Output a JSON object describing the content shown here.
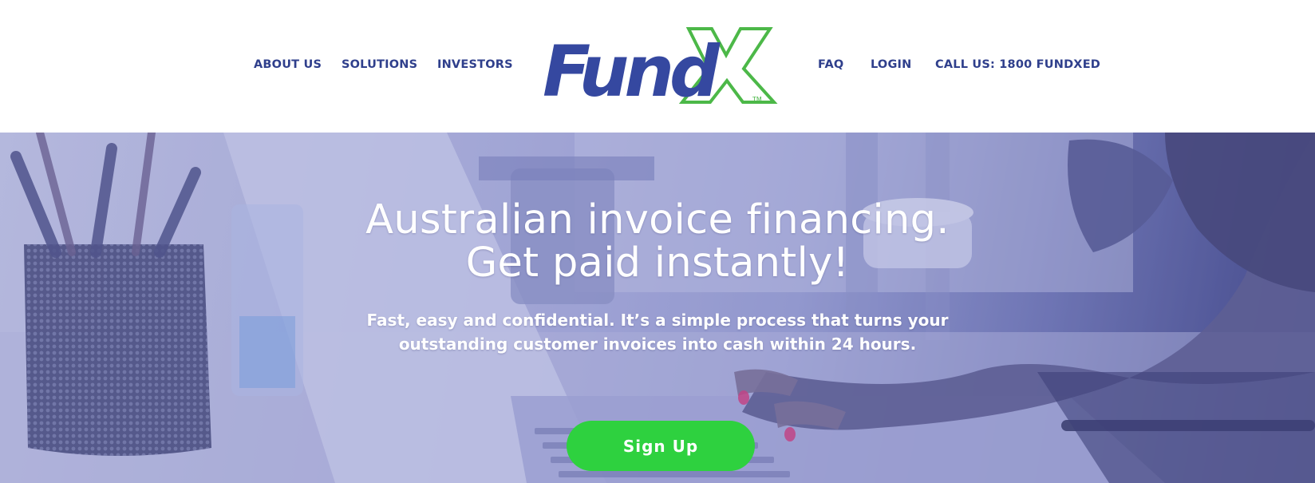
{
  "header": {
    "nav_left": [
      "ABOUT US",
      "SOLUTIONS",
      "INVESTORS"
    ],
    "nav_right": [
      "FAQ",
      "LOGIN",
      "CALL US: 1800 FUNDXED"
    ],
    "logo": {
      "text": "Fund",
      "mark": "X",
      "trademark": "TM",
      "brand_color": "#3548a0",
      "accent_color": "#4cb848"
    }
  },
  "hero": {
    "title_line1": "Australian invoice financing.",
    "title_line2": "Get paid instantly!",
    "subtitle_line1": "Fast, easy and confidential. It’s a simple process that turns your",
    "subtitle_line2": "outstanding customer invoices into cash within 24 hours.",
    "cta_label": "Sign Up",
    "cta_color": "#2ed13f"
  },
  "colors": {
    "nav_text": "#2f3f8c",
    "hero_overlay": "#7e84c8"
  }
}
